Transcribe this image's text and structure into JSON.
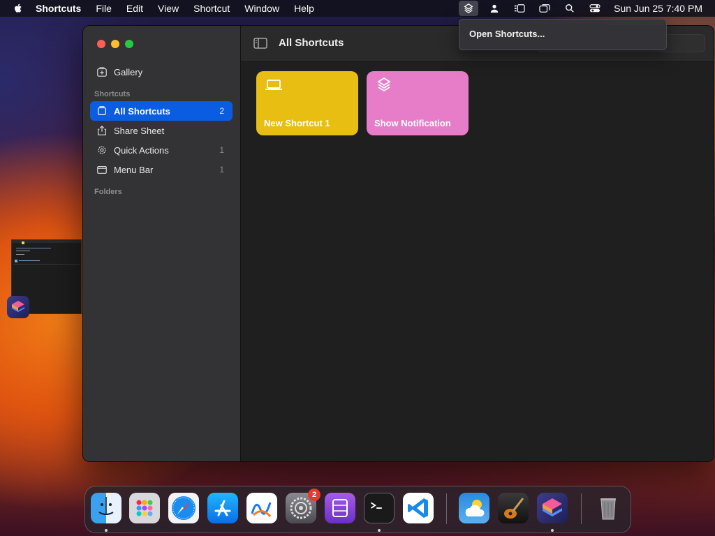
{
  "menubar": {
    "app_name": "Shortcuts",
    "items": [
      "File",
      "Edit",
      "View",
      "Shortcut",
      "Window",
      "Help"
    ],
    "clock": "Sun Jun 25  7:40 PM",
    "status_icons": [
      "shortcuts-menu-icon",
      "user-icon",
      "stage-manager-icon",
      "screen-mirroring-icon",
      "spotlight-search-icon",
      "control-center-icon"
    ]
  },
  "dropdown": {
    "item": "Open Shortcuts..."
  },
  "sidebar": {
    "gallery_label": "Gallery",
    "section_shortcuts": "Shortcuts",
    "items": [
      {
        "label": "All Shortcuts",
        "count": "2",
        "icon": "all-shortcuts-icon"
      },
      {
        "label": "Share Sheet",
        "count": "",
        "icon": "share-icon"
      },
      {
        "label": "Quick Actions",
        "count": "1",
        "icon": "gear-icon"
      },
      {
        "label": "Menu Bar",
        "count": "1",
        "icon": "menu-bar-icon"
      }
    ],
    "section_folders": "Folders"
  },
  "main": {
    "title": "All Shortcuts",
    "cards": [
      {
        "title": "New Shortcut 1",
        "color": "#e8be12",
        "icon": "laptop-icon"
      },
      {
        "title": "Show Notification",
        "color": "#e77cc9",
        "icon": "layers-icon"
      }
    ]
  },
  "dock": {
    "apps": [
      "Finder",
      "Launchpad",
      "Safari",
      "App Store",
      "Freeform",
      "System Settings",
      "Apple Configurator",
      "Terminal",
      "Visual Studio Code",
      "Weather",
      "GarageBand",
      "Shortcuts",
      "Trash"
    ],
    "settings_badge": "2"
  },
  "colors": {
    "selection": "#0a5ce0",
    "sidebar_bg": "#333335",
    "content_bg": "#1f1f1f"
  }
}
